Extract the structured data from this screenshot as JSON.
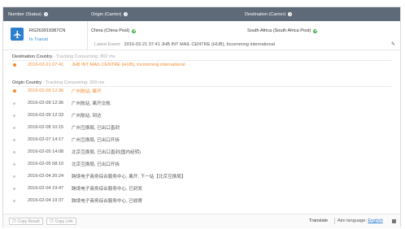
{
  "header": {
    "number_status": "Number (Status)",
    "origin_carrier": "Origin (Carrier)",
    "destination_carrier": "Destination (Carrier)"
  },
  "package": {
    "tracking_number": "RG263919387CN",
    "status": "In Transit",
    "origin": "China (China Post)",
    "destination": "South Africa (South Africa Post)",
    "latest_label": "Latest Event:",
    "latest_event": "2016-02-21 07:41  JHB INT MAIL CENTRE (HUB), Incomming international"
  },
  "destination_section": {
    "title": "Destination Country",
    "subtitle": " - Tracking Consuming: 802 ms",
    "events": [
      {
        "time": "2016-02-21 07:41",
        "desc": "JHB INT MAIL CENTRE (HUB), Incomming international"
      }
    ]
  },
  "origin_section": {
    "title": "Origin Country",
    "subtitle": " - Tracking Consuming: 269 ms",
    "events": [
      {
        "time": "2016-02-09 12:36",
        "desc": "广州航站, 离开"
      },
      {
        "time": "2016-02-09 12:36",
        "desc": "广州航站, 离开交航"
      },
      {
        "time": "2016-02-09 12:33",
        "desc": "广州航站, 到达"
      },
      {
        "time": "2016-02-08 10:15",
        "desc": "广州互换局, 已出口直封"
      },
      {
        "time": "2016-02-07 14:17",
        "desc": "广州互换局, 已出口开拆"
      },
      {
        "time": "2016-02-05 14:08",
        "desc": "北京互换局, 已出口直封(国内经转)"
      },
      {
        "time": "2016-02-05 08:10",
        "desc": "北京互换局, 已出口开拆"
      },
      {
        "time": "2016-02-04 20:24",
        "desc": "跨境电子商务综合服务中心, 离开, 下一站【北京互换局】"
      },
      {
        "time": "2016-02-04 19:47",
        "desc": "跨境电子商务综合服务中心, 已封发"
      },
      {
        "time": "2016-02-04 19:37",
        "desc": "跨境电子商务综合服务中心, 已收寄"
      }
    ]
  },
  "footer": {
    "copy_result": "Copy Result",
    "copy_link": "Copy Link",
    "translate": "Translate",
    "aim_language_label": "Aim language:",
    "aim_language_value": "English"
  },
  "colors": {
    "header_bg": "#5f6a78",
    "status_blue": "#2f8bd8",
    "highlight_orange": "#f08c2e",
    "check_green": "#3cab4a"
  }
}
